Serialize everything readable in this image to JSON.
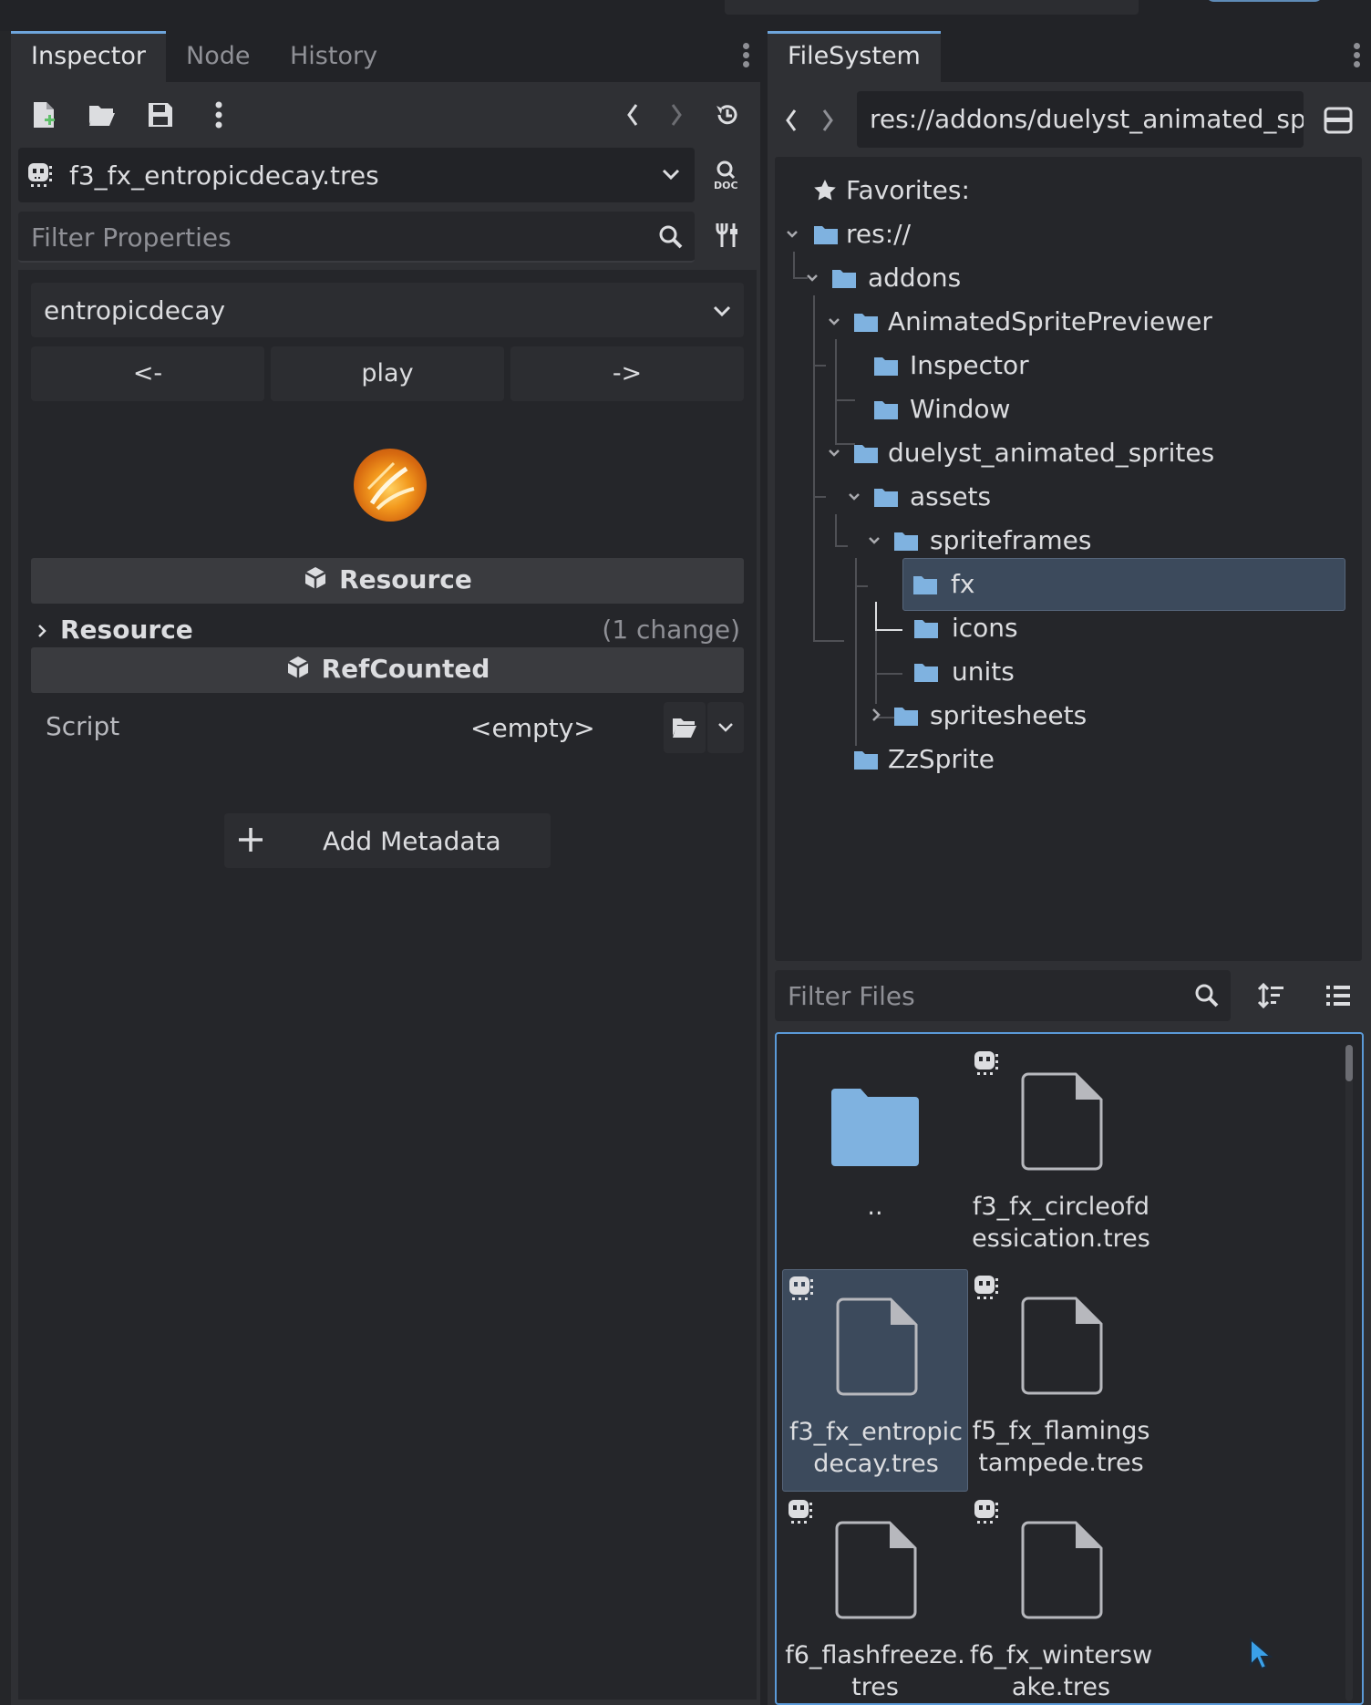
{
  "inspector_dock": {
    "tabs": [
      "Inspector",
      "Node",
      "History"
    ],
    "resource_name": "f3_fx_entropicdecay.tres",
    "filter_placeholder": "Filter Properties",
    "animation_select": "entropicdecay",
    "nav_buttons": {
      "prev": "<-",
      "play": "play",
      "next": "->"
    },
    "sections": {
      "resource_header": "Resource",
      "resource_group": "Resource",
      "resource_changes": "(1 change)",
      "refcounted_header": "RefCounted"
    },
    "script_row": {
      "label": "Script",
      "value": "<empty>"
    },
    "add_metadata_label": "Add Metadata"
  },
  "filesystem_dock": {
    "tab": "FileSystem",
    "path": "res://addons/duelyst_animated_spr",
    "tree": {
      "favorites": "Favorites:",
      "root": "res://",
      "addons": "addons",
      "animated_sprite_previewer": "AnimatedSpritePreviewer",
      "inspector": "Inspector",
      "window": "Window",
      "duelyst_animated_sprites": "duelyst_animated_sprites",
      "assets": "assets",
      "spriteframes": "spriteframes",
      "fx": "fx",
      "icons": "icons",
      "units": "units",
      "spritesheets": "spritesheets",
      "zzsprite": "ZzSprite"
    },
    "filter_placeholder": "Filter Files",
    "files": [
      {
        "name": "..",
        "kind": "folder"
      },
      {
        "name": "f3_fx_circleofdessication.tres",
        "kind": "file"
      },
      {
        "name": "f3_fx_entropicdecay.tres",
        "kind": "file",
        "selected": true
      },
      {
        "name": "f5_fx_flamingstampede.tres",
        "kind": "file"
      },
      {
        "name": "f6_flashfreeze.tres",
        "kind": "file"
      },
      {
        "name": "f6_fx_winterswake.tres",
        "kind": "file"
      }
    ]
  },
  "colors": {
    "accent": "#6ea5dc",
    "folder": "#7fb2e0",
    "selection": "#3c4a5c",
    "panel": "#2f3034",
    "panel_dark": "#25262a"
  }
}
